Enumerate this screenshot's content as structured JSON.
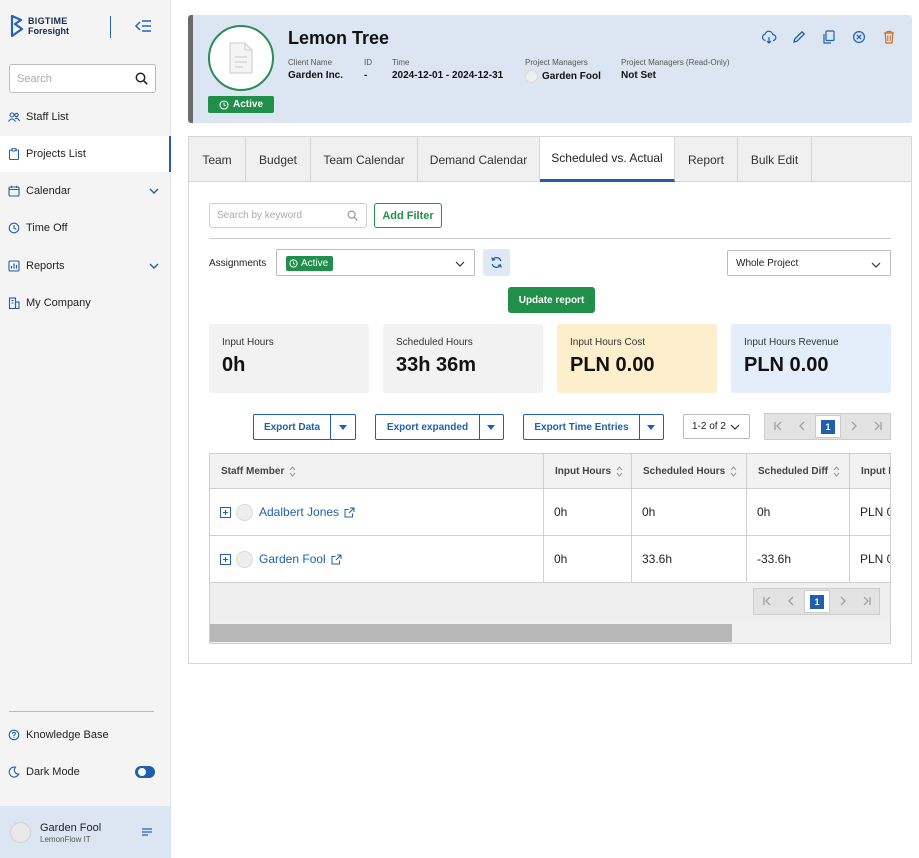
{
  "brand": {
    "line1": "BIGTIME",
    "line2": "Foresight"
  },
  "sidebar": {
    "search_placeholder": "Search",
    "items": [
      {
        "label": "Staff List",
        "icon": "users-icon"
      },
      {
        "label": "Projects List",
        "icon": "clipboard-icon",
        "active": true
      },
      {
        "label": "Calendar",
        "icon": "calendar-icon",
        "expandable": true
      },
      {
        "label": "Time Off",
        "icon": "time-off-icon"
      },
      {
        "label": "Reports",
        "icon": "reports-icon",
        "expandable": true
      },
      {
        "label": "My Company",
        "icon": "building-icon"
      }
    ],
    "bottom": {
      "knowledge_base": "Knowledge Base",
      "dark_mode": "Dark Mode",
      "dark_mode_on": true
    },
    "user": {
      "name": "Garden Fool",
      "org": "LemonFlow IT"
    }
  },
  "project": {
    "title": "Lemon Tree",
    "status": "Active",
    "meta": {
      "client_label": "Client Name",
      "client_value": "Garden Inc.",
      "id_label": "ID",
      "id_value": "-",
      "time_label": "Time",
      "time_value": "2024-12-01 - 2024-12-31",
      "pm_label": "Project Managers",
      "pm_value": "Garden Fool",
      "pm_ro_label": "Project Managers (Read-Only)",
      "pm_ro_value": "Not Set"
    },
    "actions": [
      "cloud-sync-icon",
      "edit-icon",
      "copy-icon",
      "cancel-icon",
      "delete-icon"
    ]
  },
  "tabs": [
    "Team",
    "Budget",
    "Team Calendar",
    "Demand Calendar",
    "Scheduled vs. Actual",
    "Report",
    "Bulk Edit"
  ],
  "active_tab": "Scheduled vs. Actual",
  "filters": {
    "keyword_placeholder": "Search by keyword",
    "add_filter": "Add Filter",
    "assignments_label": "Assignments",
    "assignments_value": "Active",
    "range_value": "Whole Project",
    "update_report": "Update report"
  },
  "stats": [
    {
      "label": "Input Hours",
      "value": "0h",
      "color": "#f2f2f2"
    },
    {
      "label": "Scheduled Hours",
      "value": "33h 36m",
      "color": "#f2f2f2"
    },
    {
      "label": "Input Hours Cost",
      "value": "PLN 0.00",
      "color": "#fdefcc"
    },
    {
      "label": "Input Hours Revenue",
      "value": "PLN 0.00",
      "color": "#e3eefa"
    }
  ],
  "exports": {
    "export_data": "Export Data",
    "export_expanded": "Export expanded",
    "export_time_entries": "Export Time Entries",
    "page_range": "1-2 of 2",
    "current_page": "1"
  },
  "table": {
    "columns": [
      "Staff Member",
      "Input Hours",
      "Scheduled Hours",
      "Scheduled Diff",
      "Input H"
    ],
    "rows": [
      {
        "name": "Adalbert Jones",
        "input_hours": "0h",
        "scheduled_hours": "0h",
        "scheduled_diff": "0h",
        "input_h": "PLN 0"
      },
      {
        "name": "Garden Fool",
        "input_hours": "0h",
        "scheduled_hours": "33.6h",
        "scheduled_diff": "-33.6h",
        "input_h": "PLN 0"
      }
    ],
    "footer_page": "1"
  },
  "colors": {
    "accent": "#1f5fae",
    "green": "#1f8f4a"
  }
}
